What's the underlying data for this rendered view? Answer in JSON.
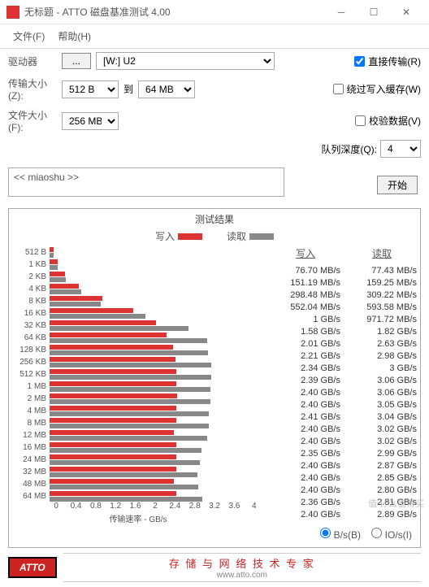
{
  "window": {
    "title": "无标题 - ATTO 磁盘基准测试 4.00"
  },
  "menu": {
    "file": "文件(F)",
    "help": "帮助(H)"
  },
  "labels": {
    "drive": "驱动器",
    "transfer_size": "传输大小(Z):",
    "to": "到",
    "file_size": "文件大小(F):",
    "direct_io": "直接传输(R)",
    "bypass_cache": "绕过写入缓存(W)",
    "verify": "校验数据(V)",
    "queue_depth": "队列深度(Q):",
    "start": "开始",
    "results": "测试结果",
    "write": "写入",
    "read": "读取",
    "xlabel": "传输速率 - GB/s",
    "unit_bs": "B/s(B)",
    "unit_ios": "IO/s(I)",
    "browse": "..."
  },
  "values": {
    "drive": "[W:] U2",
    "transfer_min": "512 B",
    "transfer_max": "64 MB",
    "file_size": "256 MB",
    "queue_depth": "4",
    "description": "<< miaoshu >>"
  },
  "checks": {
    "direct_io": true,
    "bypass_cache": false,
    "verify": false,
    "unit_bs": true,
    "unit_ios": false
  },
  "chart_data": {
    "type": "bar",
    "categories": [
      "512 B",
      "1 KB",
      "2 KB",
      "4 KB",
      "8 KB",
      "16 KB",
      "32 KB",
      "64 KB",
      "128 KB",
      "256 KB",
      "512 KB",
      "1 MB",
      "2 MB",
      "4 MB",
      "8 MB",
      "12 MB",
      "16 MB",
      "24 MB",
      "32 MB",
      "48 MB",
      "64 MB"
    ],
    "series": [
      {
        "name": "写入",
        "values": [
          0.0767,
          0.1512,
          0.2985,
          0.552,
          1.0,
          1.58,
          2.01,
          2.21,
          2.34,
          2.39,
          2.4,
          2.4,
          2.41,
          2.4,
          2.4,
          2.35,
          2.4,
          2.4,
          2.4,
          2.36,
          2.4
        ]
      },
      {
        "name": "读取",
        "values": [
          0.0774,
          0.1593,
          0.3092,
          0.5936,
          0.9717,
          1.82,
          2.63,
          2.98,
          3.0,
          3.06,
          3.06,
          3.05,
          3.04,
          3.02,
          3.02,
          2.99,
          2.87,
          2.85,
          2.8,
          2.81,
          2.89
        ]
      }
    ],
    "xlabel": "传输速率 - GB/s",
    "xlim": [
      0,
      4
    ],
    "xticks": [
      0,
      0.4,
      0.8,
      1.2,
      1.6,
      2,
      2.4,
      2.8,
      3.2,
      3.6,
      4
    ]
  },
  "value_strings": {
    "write": [
      "76.70 MB/s",
      "151.19 MB/s",
      "298.48 MB/s",
      "552.04 MB/s",
      "1 GB/s",
      "1.58 GB/s",
      "2.01 GB/s",
      "2.21 GB/s",
      "2.34 GB/s",
      "2.39 GB/s",
      "2.40 GB/s",
      "2.40 GB/s",
      "2.41 GB/s",
      "2.40 GB/s",
      "2.40 GB/s",
      "2.35 GB/s",
      "2.40 GB/s",
      "2.40 GB/s",
      "2.40 GB/s",
      "2.36 GB/s",
      "2.40 GB/s"
    ],
    "read": [
      "77.43 MB/s",
      "159.25 MB/s",
      "309.22 MB/s",
      "593.58 MB/s",
      "971.72 MB/s",
      "1.82 GB/s",
      "2.63 GB/s",
      "2.98 GB/s",
      "3 GB/s",
      "3.06 GB/s",
      "3.06 GB/s",
      "3.05 GB/s",
      "3.04 GB/s",
      "3.02 GB/s",
      "3.02 GB/s",
      "2.99 GB/s",
      "2.87 GB/s",
      "2.85 GB/s",
      "2.80 GB/s",
      "2.81 GB/s",
      "2.89 GB/s"
    ]
  },
  "footer": {
    "brand": "ATTO",
    "tagline": "存 储 与 网 络 技 术 专 家",
    "url": "www.atto.com"
  },
  "watermark": {
    "text": "值 什么值得买"
  }
}
